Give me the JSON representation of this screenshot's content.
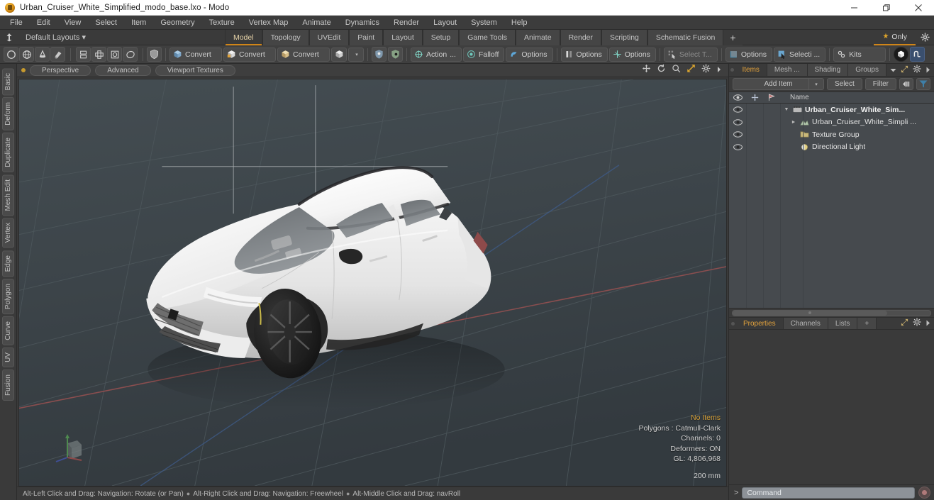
{
  "window": {
    "title": "Urban_Cruiser_White_Simplified_modo_base.lxo - Modo",
    "app_icon": "modo-cube-icon",
    "minimize": "minimize-icon",
    "maximize": "restore-icon",
    "close": "close-icon"
  },
  "menubar": {
    "items": [
      "File",
      "Edit",
      "View",
      "Select",
      "Item",
      "Geometry",
      "Texture",
      "Vertex Map",
      "Animate",
      "Dynamics",
      "Render",
      "Layout",
      "System",
      "Help"
    ]
  },
  "layoutbar": {
    "anchor_icon": "anchor-icon",
    "layout_selector": "Default Layouts",
    "layout_caret": "▾",
    "tabs": [
      {
        "label": "Model",
        "active": true
      },
      {
        "label": "Topology",
        "active": false
      },
      {
        "label": "UVEdit",
        "active": false
      },
      {
        "label": "Paint",
        "active": false
      },
      {
        "label": "Layout",
        "active": false
      },
      {
        "label": "Setup",
        "active": false
      },
      {
        "label": "Game Tools",
        "active": false
      },
      {
        "label": "Animate",
        "active": false
      },
      {
        "label": "Render",
        "active": false
      },
      {
        "label": "Scripting",
        "active": false
      },
      {
        "label": "Schematic Fusion",
        "active": false
      }
    ],
    "add_tab": "+",
    "only_star": "★",
    "only_label": "Only",
    "prefs_icon": "gear-icon"
  },
  "toolbar": {
    "shape_icons": [
      "circle-icon",
      "sphere-icon",
      "cone-icon",
      "paint-drip-icon"
    ],
    "mesh_icons": [
      "mirror-icon",
      "bevel-icon",
      "square-target-icon",
      "ellipse-icon"
    ],
    "shield_icon": "shield-icon",
    "convert_buttons": [
      {
        "label": "Convert",
        "icon": "convert-blue-cube-icon"
      },
      {
        "label": "Convert",
        "icon": "convert-white-cube-icon"
      },
      {
        "label": "Convert",
        "icon": "convert-tan-cube-icon"
      }
    ],
    "convert_extra": {
      "icon": "convert-cube-icon",
      "caret": "▾"
    },
    "shield_pair": [
      "shield-blue-icon",
      "shield-green-icon"
    ],
    "option_buttons": [
      {
        "label": "Action",
        "icon": "action-center-icon",
        "suffix": "...",
        "dim": false
      },
      {
        "label": "Falloff",
        "icon": "falloff-icon",
        "dim": false
      },
      {
        "label": "Options",
        "icon": "snapping-icon",
        "dim": false
      },
      {
        "label": "Options",
        "icon": "symmetry-icon",
        "dim": false
      },
      {
        "label": "Options",
        "icon": "workplane-icon",
        "dim": false
      },
      {
        "label": "Select T...",
        "icon": "select-through-icon",
        "dim": true
      },
      {
        "label": "Options",
        "icon": "grid-options-icon",
        "dim": false
      },
      {
        "label": "Selecti ...",
        "icon": "selection-set-icon",
        "dim": false
      },
      {
        "label": "Kits",
        "icon": "kits-gear-icon",
        "dim": false
      }
    ],
    "right_icons": [
      "preview-render-icon",
      "unity-bridge-icon"
    ]
  },
  "left_tabs": [
    "Basic",
    "Deform",
    "Duplicate",
    "Mesh Edit",
    "Vertex",
    "Edge",
    "Polygon",
    "Curve",
    "UV",
    "Fusion"
  ],
  "viewport": {
    "header": {
      "dot": "active-viewport-dot",
      "pills": [
        "Perspective",
        "Advanced",
        "Viewport Textures"
      ],
      "icons": [
        "move-icon",
        "rotate-icon",
        "zoom-icon",
        "fit-icon",
        "gear-icon",
        "chevron-right-icon"
      ]
    },
    "info": {
      "selection": "No Items",
      "polygons": "Polygons : Catmull-Clark",
      "channels": "Channels: 0",
      "deformers": "Deformers: ON",
      "gl": "GL: 4,806,968"
    },
    "scale_label": "200 mm",
    "axis_gizmo": "axis-gizmo-icon",
    "model": "white-suv-car-model",
    "colors": {
      "background_top": "#414a4f",
      "background_bottom": "#343b40",
      "grid_line": "#4a5459",
      "x_axis": "#8a4a4a",
      "z_axis": "#3f5580",
      "car_body": "#f2f2f2",
      "car_glass": "#6e7276",
      "car_tire": "#1c1c1c",
      "accent": "#d6a13a"
    }
  },
  "statusbar": {
    "hints": [
      "Alt-Left Click and Drag: Navigation: Rotate (or Pan)",
      "Alt-Right Click and Drag: Navigation: Freewheel",
      "Alt-Middle Click and Drag: navRoll"
    ],
    "separator": "●"
  },
  "rightpanel": {
    "tabs": [
      {
        "label": "Items",
        "active": true
      },
      {
        "label": "Mesh ...",
        "active": false
      },
      {
        "label": "Shading",
        "active": false
      },
      {
        "label": "Groups",
        "active": false
      }
    ],
    "tab_icons": [
      "chevron-down-icon",
      "expand-icon",
      "gear-icon",
      "chevron-right-icon"
    ],
    "toolrow": {
      "add_item": "Add Item",
      "add_item_caret": "▾",
      "select": "Select",
      "filter": "Filter",
      "icon_left": "collapse-left-icon",
      "icon_funnel": "funnel-icon"
    },
    "list_header": {
      "eye_icon": "eye-icon",
      "lock_icon": "move-lock-icon",
      "render_icon": "render-flag-icon",
      "name_column": "Name"
    },
    "items": [
      {
        "label": "Urban_Cruiser_White_Sim...",
        "icon": "scene-icon",
        "depth": 0,
        "twisty": "▼",
        "eye": "eye-icon",
        "bold": true
      },
      {
        "label": "Urban_Cruiser_White_Simpli ...",
        "icon": "mesh-icon",
        "depth": 1,
        "twisty": "►",
        "eye": "eye-icon",
        "bold": false
      },
      {
        "label": "Texture Group",
        "icon": "texture-group-icon",
        "depth": 1,
        "twisty": "",
        "eye": "eye-icon",
        "bold": false
      },
      {
        "label": "Directional Light",
        "icon": "light-icon",
        "depth": 1,
        "twisty": "",
        "eye": "eye-icon",
        "bold": false
      }
    ],
    "bottom_tabs": [
      {
        "label": "Properties",
        "active": true
      },
      {
        "label": "Channels",
        "active": false
      },
      {
        "label": "Lists",
        "active": false
      },
      {
        "label": "+",
        "active": false
      }
    ],
    "bottom_tab_icons": [
      "expand-icon",
      "gear-icon",
      "chevron-right-icon"
    ]
  },
  "commandbar": {
    "prompt": ">",
    "placeholder": "Command",
    "record_icon": "record-icon"
  }
}
